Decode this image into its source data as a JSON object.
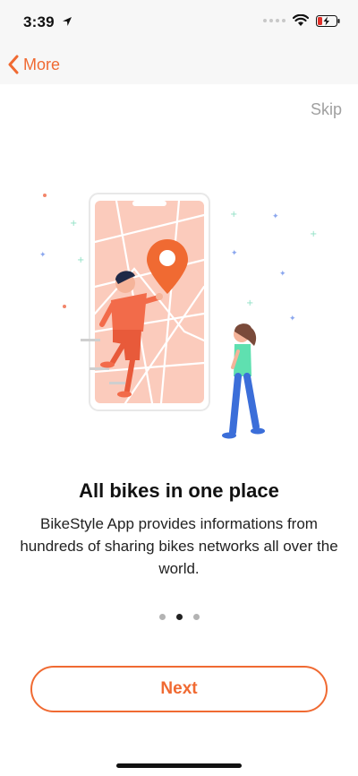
{
  "status_bar": {
    "time": "3:39",
    "location_icon": "location-arrow-icon",
    "wifi_icon": "wifi-icon",
    "battery_icon": "battery-charging-icon"
  },
  "nav": {
    "back_label": "More",
    "back_icon": "chevron-left-icon"
  },
  "onboarding": {
    "skip_label": "Skip",
    "title": "All bikes in one place",
    "description": "BikeStyle App provides informations from hundreds of sharing bikes networks all over the world.",
    "page_count": 3,
    "current_page": 2,
    "next_label": "Next"
  },
  "colors": {
    "accent": "#f06a32",
    "map_background": "#fbcbbc",
    "pin": "#f06a32"
  }
}
